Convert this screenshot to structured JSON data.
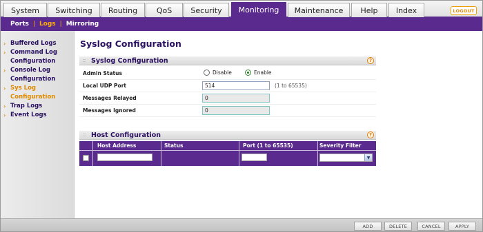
{
  "top_tabs": [
    {
      "label": "System"
    },
    {
      "label": "Switching"
    },
    {
      "label": "Routing"
    },
    {
      "label": "QoS"
    },
    {
      "label": "Security"
    },
    {
      "label": "Monitoring",
      "active": true
    },
    {
      "label": "Maintenance"
    },
    {
      "label": "Help"
    },
    {
      "label": "Index"
    }
  ],
  "logout_label": "LOGOUT",
  "subnav": {
    "ports": "Ports",
    "logs": "Logs",
    "mirroring": "Mirroring",
    "separator": "|",
    "active": "Logs"
  },
  "sidebar": {
    "arrow": "›",
    "items": [
      {
        "line1": "Buffered Logs"
      },
      {
        "line1": "Command Log",
        "line2": "Configuration"
      },
      {
        "line1": "Console Log",
        "line2": "Configuration"
      },
      {
        "line1": "Sys Log",
        "line2": "Configuration",
        "active": true
      },
      {
        "line1": "Trap Logs"
      },
      {
        "line1": "Event Logs"
      }
    ]
  },
  "page_title": "Syslog Configuration",
  "syslog_panel": {
    "title": "Syslog Configuration",
    "help": "?",
    "grip": "::",
    "admin_status": {
      "label": "Admin Status",
      "disable_label": "Disable",
      "enable_label": "Enable",
      "selected": "Enable"
    },
    "local_udp_port": {
      "label": "Local UDP Port",
      "value": "514",
      "hint": "(1 to 65535)"
    },
    "messages_relayed": {
      "label": "Messages Relayed",
      "value": "0"
    },
    "messages_ignored": {
      "label": "Messages Ignored",
      "value": "0"
    }
  },
  "host_panel": {
    "title": "Host Configuration",
    "help": "?",
    "grip": "::",
    "columns": [
      "Host Address",
      "Status",
      "Port (1 to 65535)",
      "Severity Filter"
    ],
    "dropdown_arrow": "▼"
  },
  "footer_buttons": [
    "ADD",
    "DELETE",
    "CANCEL",
    "APPLY"
  ],
  "colors": {
    "brand_purple": "#5b2a8e",
    "accent_orange": "#e08a00"
  }
}
